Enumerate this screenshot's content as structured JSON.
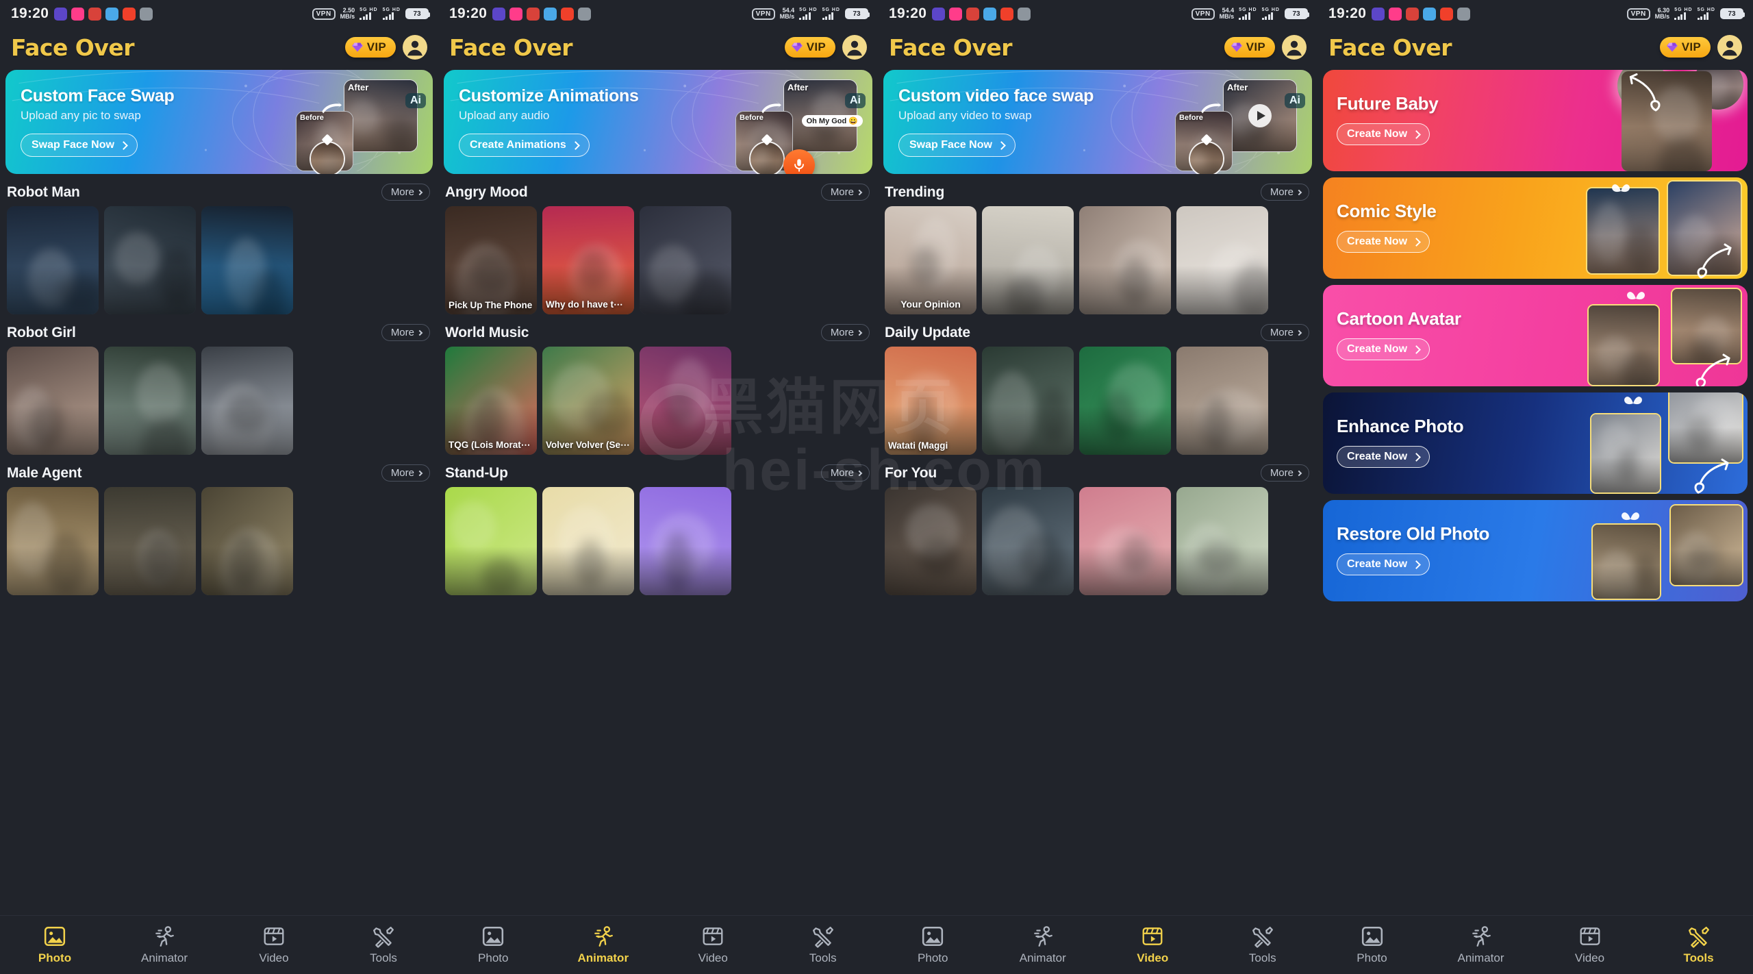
{
  "status_bar": {
    "time": "19:20",
    "vpn": "VPN",
    "speeds": [
      "2.50",
      "54.4",
      "54.4",
      "6.30"
    ],
    "speed_unit": "MB/s",
    "network_label": "5G",
    "hd_label": "HD",
    "battery": "73",
    "app_icon_names": [
      "play-icon",
      "pink-app-icon",
      "social-app-icon",
      "mail-app-icon",
      "red-app-icon",
      "gray-app-icon"
    ]
  },
  "header": {
    "title": "Face Over",
    "vip_label": "VIP",
    "vip_icon": "diamond-icon",
    "avatar_icon": "user-avatar-icon"
  },
  "panels": [
    {
      "id": "photo",
      "hero": {
        "title": "Custom Face Swap",
        "subtitle": "Upload any pic to swap",
        "button": "Swap Face Now",
        "before_tag": "Before",
        "after_tag": "After",
        "ai_badge": "Ai"
      },
      "sections": [
        {
          "title": "Robot Man",
          "more": "More",
          "items": [
            {
              "caption": "",
              "c1": "#1b2738",
              "c2": "#3e5a77"
            },
            {
              "caption": "",
              "c1": "#202a33",
              "c2": "#4a5763"
            },
            {
              "caption": "",
              "c1": "#17212e",
              "c2": "#2f7fb8"
            }
          ]
        },
        {
          "title": "Robot Girl",
          "more": "More",
          "items": [
            {
              "caption": "",
              "c1": "#5a4b46",
              "c2": "#c0a797"
            },
            {
              "caption": "",
              "c1": "#2d3b33",
              "c2": "#8fa39a"
            },
            {
              "caption": "",
              "c1": "#3a3f46",
              "c2": "#b6bcc4"
            }
          ]
        },
        {
          "title": "Male Agent",
          "more": "More",
          "items": [
            {
              "caption": "",
              "c1": "#6b5a3d",
              "c2": "#c8b188"
            },
            {
              "caption": "",
              "c1": "#3c3a31",
              "c2": "#7e7461"
            },
            {
              "caption": "",
              "c1": "#4a4434",
              "c2": "#968a6a"
            }
          ]
        }
      ],
      "nav_active": "Photo"
    },
    {
      "id": "animator",
      "hero": {
        "title": "Customize Animations",
        "subtitle": "Upload any audio",
        "button": "Create Animations",
        "before_tag": "Before",
        "after_tag": "After",
        "ai_badge": "Ai",
        "bubble": "Oh My God"
      },
      "sections": [
        {
          "title": "Angry Mood",
          "more": "More",
          "items": [
            {
              "caption": "Pick Up The Phone",
              "c1": "#3a2a22",
              "c2": "#6d5244"
            },
            {
              "caption": "Why do I have t⋯",
              "c1": "#b52a52",
              "c2": "#f06a3a"
            },
            {
              "caption": "",
              "c1": "#2c2f3c",
              "c2": "#575b6a"
            }
          ]
        },
        {
          "title": "World Music",
          "more": "More",
          "items": [
            {
              "caption": "TQG (Lois Morat⋯",
              "c1": "#1f7a3c",
              "c2": "#e06a5e"
            },
            {
              "caption": "Volver Volver (Se⋯",
              "c1": "#3f7a4a",
              "c2": "#e2a86a"
            },
            {
              "caption": "",
              "c1": "#6b2f64",
              "c2": "#c05a78"
            }
          ]
        },
        {
          "title": "Stand-Up",
          "more": "More",
          "items": [
            {
              "caption": "",
              "c1": "#a9d94a",
              "c2": "#cfe88a"
            },
            {
              "caption": "",
              "c1": "#e8dca8",
              "c2": "#f2ead0"
            },
            {
              "caption": "",
              "c1": "#8e6ae0",
              "c2": "#b39af0"
            }
          ]
        }
      ],
      "nav_active": "Animator"
    },
    {
      "id": "video",
      "hero": {
        "title": "Custom video face swap",
        "subtitle": "Upload any video to swap",
        "button": "Swap Face Now",
        "before_tag": "Before",
        "after_tag": "After",
        "ai_badge": "Ai"
      },
      "sections": [
        {
          "title": "Trending",
          "more": "More",
          "items": [
            {
              "caption": "Your Opinion",
              "c1": "#d8cfc6",
              "c2": "#b09a8c"
            },
            {
              "caption": "",
              "c1": "#d6d2c8",
              "c2": "#a6a29a"
            },
            {
              "caption": "",
              "c1": "#8f7f76",
              "c2": "#d9cabd"
            },
            {
              "caption": "",
              "c1": "#cdc7c0",
              "c2": "#efeae4"
            }
          ]
        },
        {
          "title": "Daily Update",
          "more": "More",
          "items": [
            {
              "caption": "Watati (Maggi",
              "c1": "#d06a4a",
              "c2": "#e8b07a"
            },
            {
              "caption": "",
              "c1": "#2a3a33",
              "c2": "#6d8076"
            },
            {
              "caption": "",
              "c1": "#1d6b3f",
              "c2": "#3f9e63"
            },
            {
              "caption": "",
              "c1": "#8a7a6e",
              "c2": "#c8b8a8"
            }
          ]
        },
        {
          "title": "For You",
          "more": "More",
          "items": [
            {
              "caption": "",
              "c1": "#3a3430",
              "c2": "#7a6a5c"
            },
            {
              "caption": "",
              "c1": "#2f3b44",
              "c2": "#6e7d88"
            },
            {
              "caption": "",
              "c1": "#cf7d8e",
              "c2": "#eab6b6"
            },
            {
              "caption": "",
              "c1": "#97a88f",
              "c2": "#d4ddc9"
            }
          ]
        }
      ],
      "nav_active": "Video"
    }
  ],
  "tools_panel": {
    "cards": [
      {
        "title": "Future Baby",
        "button": "Create Now",
        "theme": "c-baby"
      },
      {
        "title": "Comic Style",
        "button": "Create Now",
        "theme": "c-comic"
      },
      {
        "title": "Cartoon Avatar",
        "button": "Create Now",
        "theme": "c-cart"
      },
      {
        "title": "Enhance Photo",
        "button": "Create Now",
        "theme": "c-enh"
      },
      {
        "title": "Restore Old Photo",
        "button": "Create Now",
        "theme": "c-rest"
      }
    ],
    "nav_active": "Tools"
  },
  "bottom_nav": {
    "items": [
      {
        "label": "Photo",
        "icon": "photo-icon"
      },
      {
        "label": "Animator",
        "icon": "running-person-icon"
      },
      {
        "label": "Video",
        "icon": "video-clapper-icon"
      },
      {
        "label": "Tools",
        "icon": "tools-wrench-icon"
      }
    ]
  },
  "watermark": {
    "line1": "黑猫网页",
    "line2": "hei-sh.com"
  },
  "colors": {
    "accent_gold": "#f2d24b",
    "panel_bg": "#21242b",
    "vip_gold": "#ffc93c"
  }
}
